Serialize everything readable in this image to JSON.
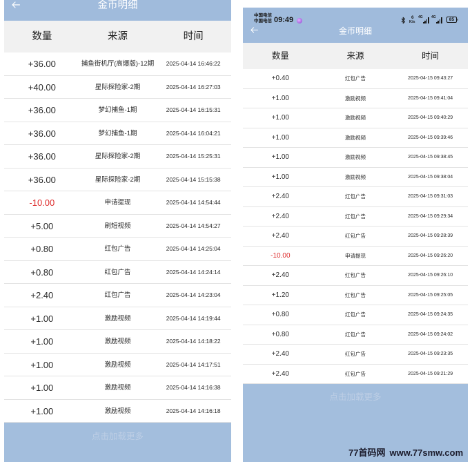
{
  "colors": {
    "header_blue": "#a0bbdc",
    "footer_blue": "#a3bedd",
    "negative_amount": "#dd2b2b",
    "load_more_text": "#bdcee5"
  },
  "icons": {
    "back": "back-arrow-icon",
    "bluetooth": "bluetooth-icon",
    "signal": "signal-strength-icon",
    "battery": "battery-icon",
    "notification": "app-notification-icon"
  },
  "left_panel": {
    "nav": {
      "title": "金币明细"
    },
    "columns": {
      "amount": "数量",
      "source": "来源",
      "time": "时间"
    },
    "rows": [
      {
        "amount": "+36.00",
        "source": "捕鱼街机厅(高爆版)-12期",
        "time": "2025-04-14 16:46:22"
      },
      {
        "amount": "+40.00",
        "source": "星际探险家-2期",
        "time": "2025-04-14 16:27:03"
      },
      {
        "amount": "+36.00",
        "source": "梦幻捕鱼-1期",
        "time": "2025-04-14 16:15:31"
      },
      {
        "amount": "+36.00",
        "source": "梦幻捕鱼-1期",
        "time": "2025-04-14 16:04:21"
      },
      {
        "amount": "+36.00",
        "source": "星际探险家-2期",
        "time": "2025-04-14 15:25:31"
      },
      {
        "amount": "+36.00",
        "source": "星际探险家-2期",
        "time": "2025-04-14 15:15:38"
      },
      {
        "amount": "-10.00",
        "source": "申请提现",
        "time": "2025-04-14 14:54:44"
      },
      {
        "amount": "+5.00",
        "source": "刷短视频",
        "time": "2025-04-14 14:54:27"
      },
      {
        "amount": "+0.80",
        "source": "红包广告",
        "time": "2025-04-14 14:25:04"
      },
      {
        "amount": "+0.80",
        "source": "红包广告",
        "time": "2025-04-14 14:24:14"
      },
      {
        "amount": "+2.40",
        "source": "红包广告",
        "time": "2025-04-14 14:23:04"
      },
      {
        "amount": "+1.00",
        "source": "激励视频",
        "time": "2025-04-14 14:19:44"
      },
      {
        "amount": "+1.00",
        "source": "激励视频",
        "time": "2025-04-14 14:18:22"
      },
      {
        "amount": "+1.00",
        "source": "激励视频",
        "time": "2025-04-14 14:17:51"
      },
      {
        "amount": "+1.00",
        "source": "激励视频",
        "time": "2025-04-14 14:16:38"
      },
      {
        "amount": "+1.00",
        "source": "激励视频",
        "time": "2025-04-14 14:16:18"
      }
    ],
    "load_more": "点击加载更多"
  },
  "right_panel": {
    "status_bar": {
      "carrier_1": "中国电信",
      "carrier_2": "中国电信",
      "clock": "09:49",
      "net_speed": "6",
      "net_speed_unit": "K/s",
      "network_1": "4G",
      "network_2": "4G",
      "battery_level": "85"
    },
    "nav": {
      "title": "金币明细"
    },
    "columns": {
      "amount": "数量",
      "source": "来源",
      "time": "时间"
    },
    "rows": [
      {
        "amount": "+0.40",
        "source": "红包广告",
        "time": "2025-04-15 09:43:27"
      },
      {
        "amount": "+1.00",
        "source": "激励视频",
        "time": "2025-04-15 09:41:04"
      },
      {
        "amount": "+1.00",
        "source": "激励视频",
        "time": "2025-04-15 09:40:29"
      },
      {
        "amount": "+1.00",
        "source": "激励视频",
        "time": "2025-04-15 09:39:46"
      },
      {
        "amount": "+1.00",
        "source": "激励视频",
        "time": "2025-04-15 09:38:45"
      },
      {
        "amount": "+1.00",
        "source": "激励视频",
        "time": "2025-04-15 09:38:04"
      },
      {
        "amount": "+2.40",
        "source": "红包广告",
        "time": "2025-04-15 09:31:03"
      },
      {
        "amount": "+2.40",
        "source": "红包广告",
        "time": "2025-04-15 09:29:34"
      },
      {
        "amount": "+2.40",
        "source": "红包广告",
        "time": "2025-04-15 09:28:39"
      },
      {
        "amount": "-10.00",
        "source": "申请提现",
        "time": "2025-04-15 09:26:20"
      },
      {
        "amount": "+2.40",
        "source": "红包广告",
        "time": "2025-04-15 09:26:10"
      },
      {
        "amount": "+1.20",
        "source": "红包广告",
        "time": "2025-04-15 09:25:05"
      },
      {
        "amount": "+0.80",
        "source": "红包广告",
        "time": "2025-04-15 09:24:35"
      },
      {
        "amount": "+0.80",
        "source": "红包广告",
        "time": "2025-04-15 09:24:02"
      },
      {
        "amount": "+2.40",
        "source": "红包广告",
        "time": "2025-04-15 09:23:35"
      },
      {
        "amount": "+2.40",
        "source": "红包广告",
        "time": "2025-04-15 09:21:29"
      }
    ],
    "load_more": "点击加载更多"
  },
  "watermark": {
    "site_name": "77首码网",
    "url": "www.77smw.com"
  }
}
